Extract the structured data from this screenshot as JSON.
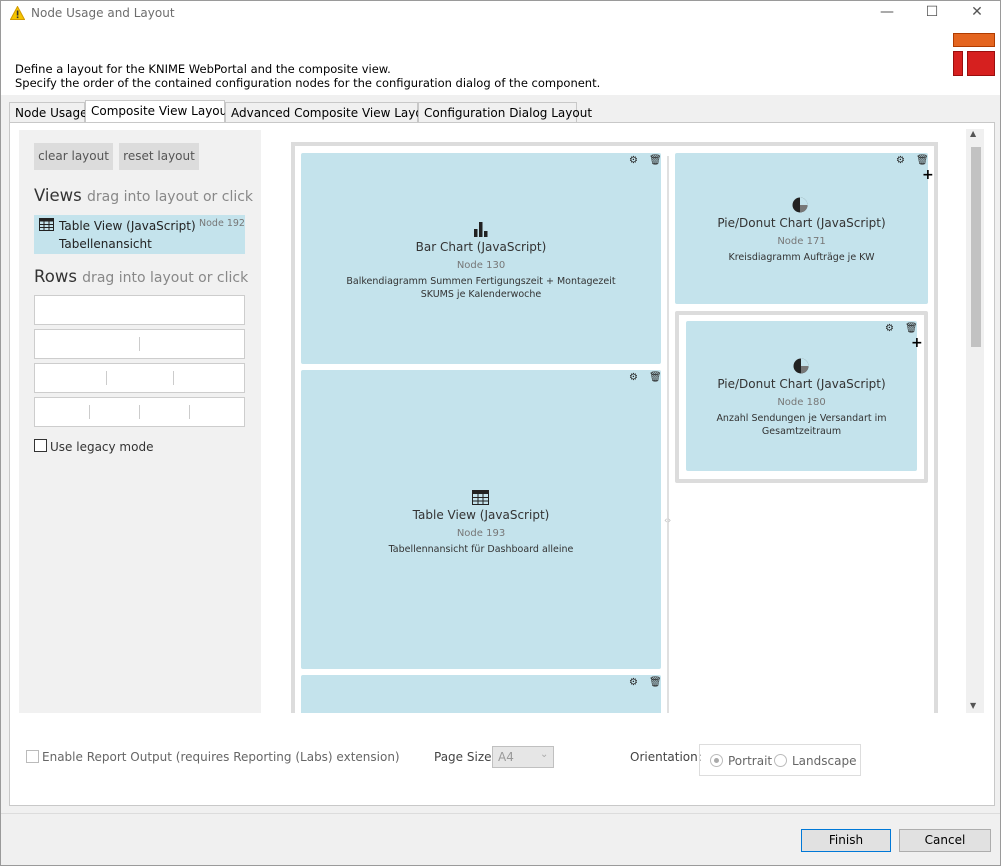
{
  "window": {
    "title": "Node Usage and Layout",
    "minimize": "—",
    "maximize": "☐",
    "close": "✕"
  },
  "header": {
    "line1": "Define a layout for the KNIME WebPortal and the composite view.",
    "line2": "Specify the order of the contained configuration nodes for the configuration dialog of the component."
  },
  "tabs": [
    {
      "label": "Node Usage"
    },
    {
      "label": "Composite View Layout"
    },
    {
      "label": "Advanced Composite View Layout"
    },
    {
      "label": "Configuration Dialog Layout"
    }
  ],
  "left": {
    "clear_layout": "clear layout",
    "reset_layout": "reset layout",
    "views_title": "Views",
    "views_hint": "drag into layout or click",
    "view_item": {
      "title": "Table View (JavaScript)",
      "node": "Node 192",
      "subtitle": "Tabellenansicht"
    },
    "rows_title": "Rows",
    "rows_hint": "drag into layout or click",
    "legacy_label": "Use legacy mode"
  },
  "cards": {
    "bar": {
      "title": "Bar Chart (JavaScript)",
      "node": "Node 130",
      "desc": "Balkendiagramm Summen Fertigungszeit + Montagezeit SKUMS je Kalenderwoche"
    },
    "table": {
      "title": "Table View (JavaScript)",
      "node": "Node 193",
      "desc": "Tabellennansicht für Dashboard alleine"
    },
    "pie1": {
      "title": "Pie/Donut Chart (JavaScript)",
      "node": "Node 171",
      "desc": "Kreisdiagramm Aufträge je KW"
    },
    "pie2": {
      "title": "Pie/Donut Chart (JavaScript)",
      "node": "Node 180",
      "desc": "Anzahl Sendungen je Versandart im Gesamtzeitraum"
    }
  },
  "footer": {
    "report_label": "Enable Report Output (requires Reporting (Labs) extension)",
    "page_size_label": "Page Size:",
    "page_size_value": "A4",
    "orientation_label": "Orientation:",
    "portrait": "Portrait",
    "landscape": "Landscape"
  },
  "buttons": {
    "finish": "Finish",
    "cancel": "Cancel"
  },
  "colors": {
    "card": "#c4e3ec",
    "accent": "#0078d7",
    "logo_orange": "#e4651f",
    "logo_red": "#d6201f"
  }
}
